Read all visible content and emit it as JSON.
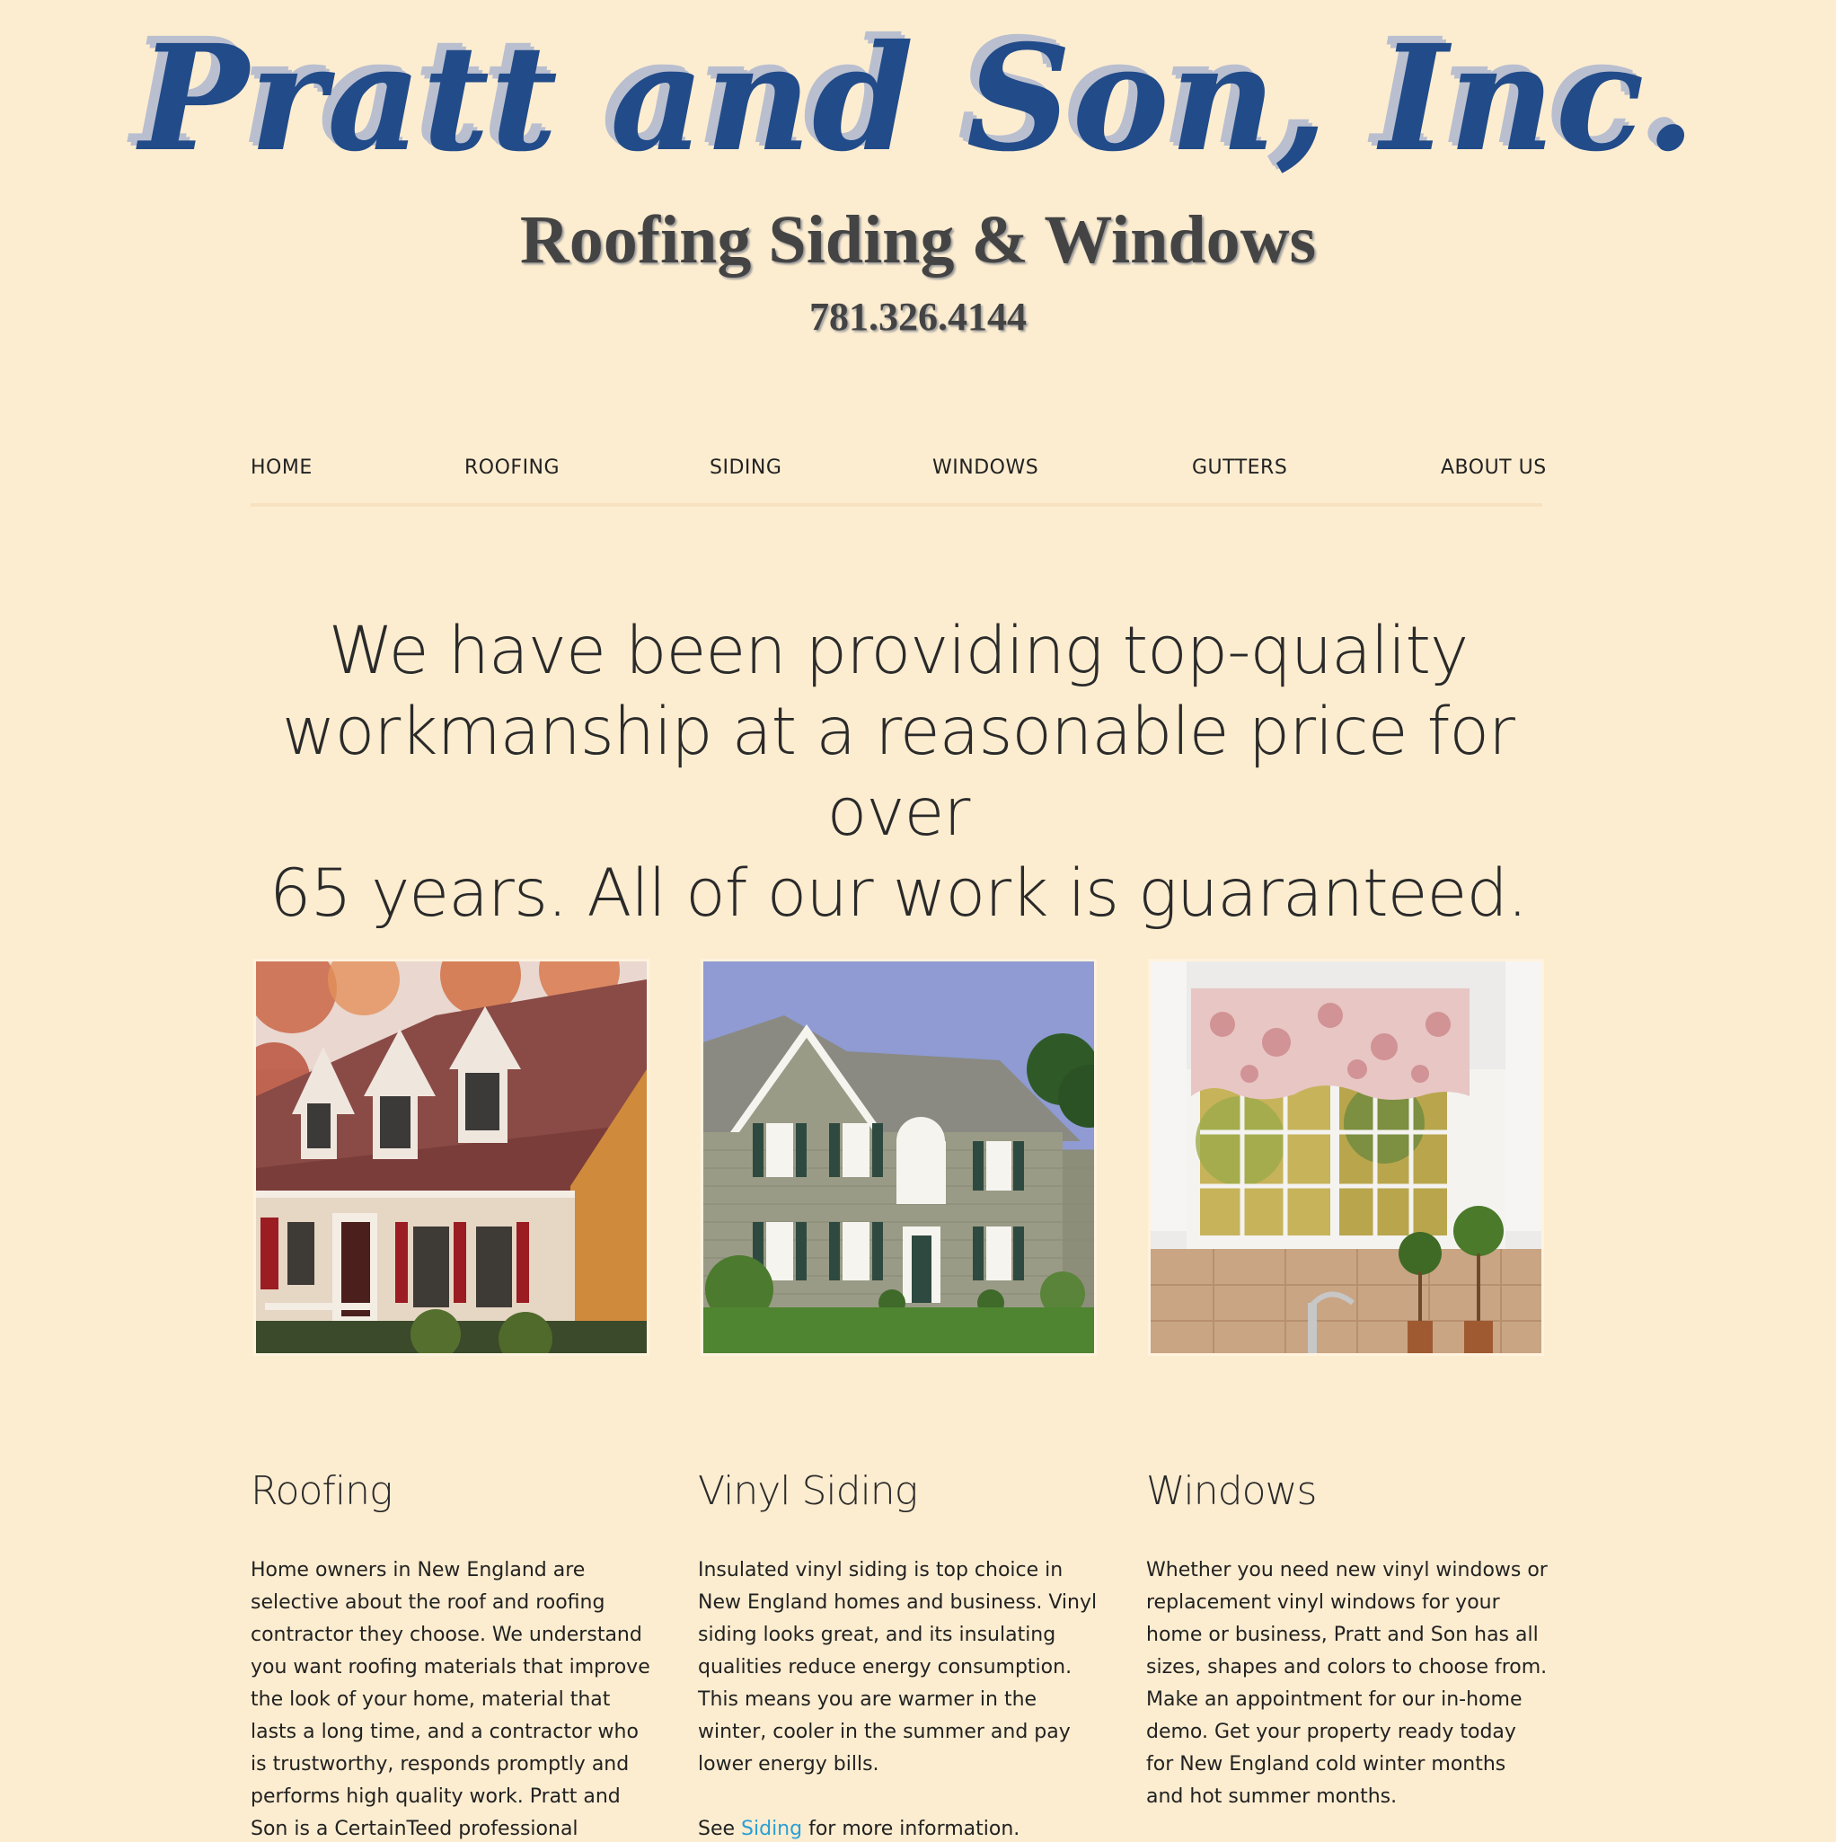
{
  "header": {
    "company_name": "Pratt and Son, Inc.",
    "tagline": "Roofing Siding & Windows",
    "phone": "781.326.4144"
  },
  "nav": {
    "items": [
      {
        "label": "HOME"
      },
      {
        "label": "ROOFING"
      },
      {
        "label": "SIDING"
      },
      {
        "label": "WINDOWS"
      },
      {
        "label": "GUTTERS"
      },
      {
        "label": "ABOUT US"
      }
    ]
  },
  "hero": {
    "line1": "We have been providing top-quality",
    "line2": "workmanship at a reasonable price for over",
    "line3": "65 years. All of our work is guaranteed."
  },
  "columns": [
    {
      "title": "Roofing",
      "body": "Home owners in New England are selective about the roof and roofing contractor they choose. We understand you want roofing materials that improve the look of your home, material that lasts a long time, and a contractor who is trustworthy, responds promptly and performs high quality work. Pratt and Son is a CertainTeed professional roofing"
    },
    {
      "title": "Vinyl Siding",
      "body": "Insulated vinyl siding is top choice in New England homes and business. Vinyl siding looks great, and its insulating qualities reduce energy consumption. This means you are warmer in the winter, cooler in the summer and pay lower energy bills.",
      "see_prefix": "See ",
      "see_link": "Siding",
      "see_suffix": " for more information."
    },
    {
      "title": "Windows",
      "body": "Whether you need new vinyl windows or replacement vinyl windows for your home or business, Pratt and Son has all sizes, shapes and colors to choose from. Make an appointment for our in-home demo. Get your property ready today for New England cold winter months and hot summer months."
    }
  ],
  "colors": {
    "background": "#fdedd0",
    "logo_blue": "#224b89",
    "link_blue": "#2a9fd6",
    "text": "#222222"
  }
}
